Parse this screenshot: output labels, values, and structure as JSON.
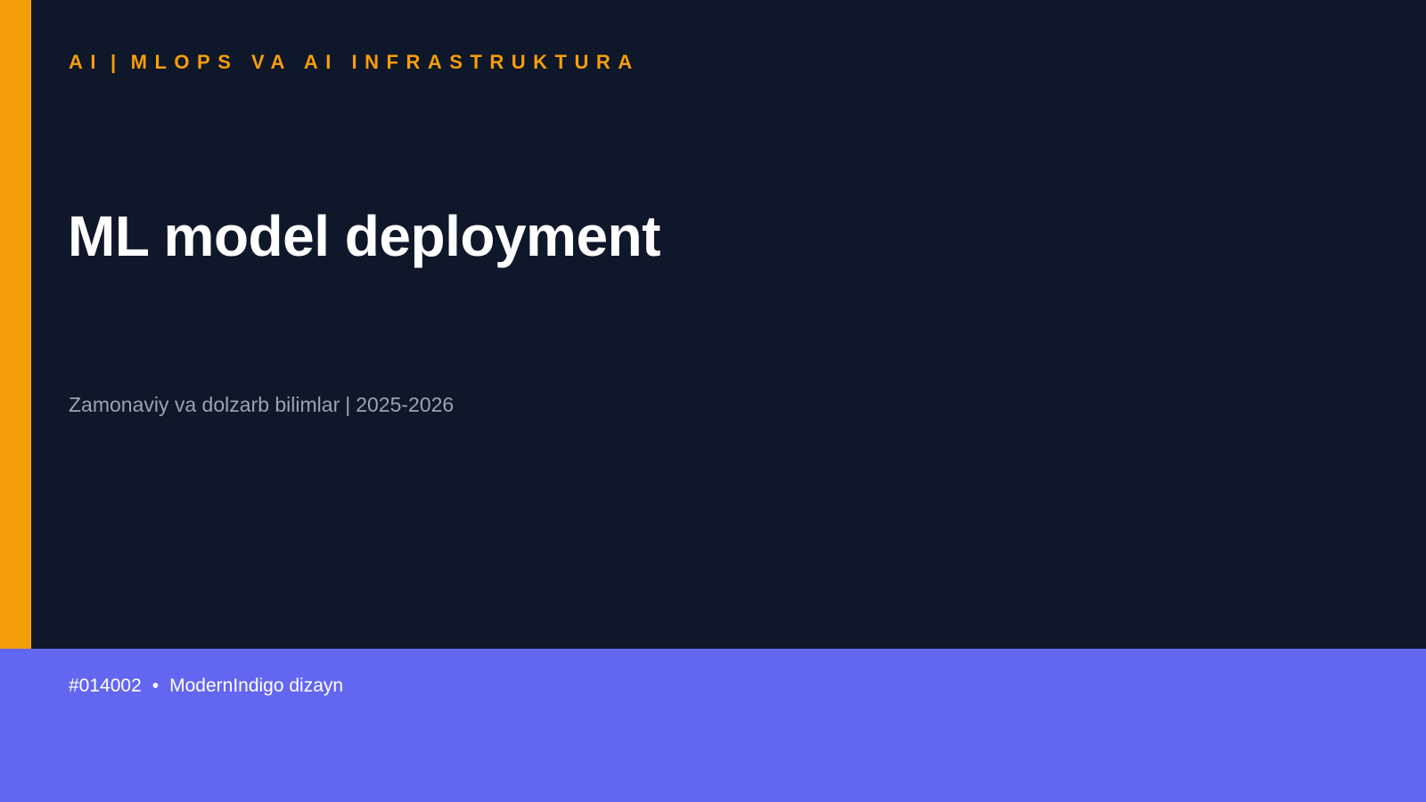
{
  "slide": {
    "category": {
      "part1": "AI",
      "separator": "|",
      "part2": "MLOPS VA AI INFRASTRUKTURA"
    },
    "title": "ML model deployment",
    "subtitle": {
      "part1": "Zamonaviy va dolzarb bilimlar",
      "separator": "|",
      "part2": "2025-2026"
    },
    "footer": {
      "id": "#014002",
      "bullet": "•",
      "design": "ModernIndigo dizayn"
    }
  },
  "colors": {
    "background": "#0f172a",
    "accent": "#f59e0b",
    "footer": "#6366f1",
    "title": "#ffffff",
    "subtitle": "#9ca3af"
  }
}
